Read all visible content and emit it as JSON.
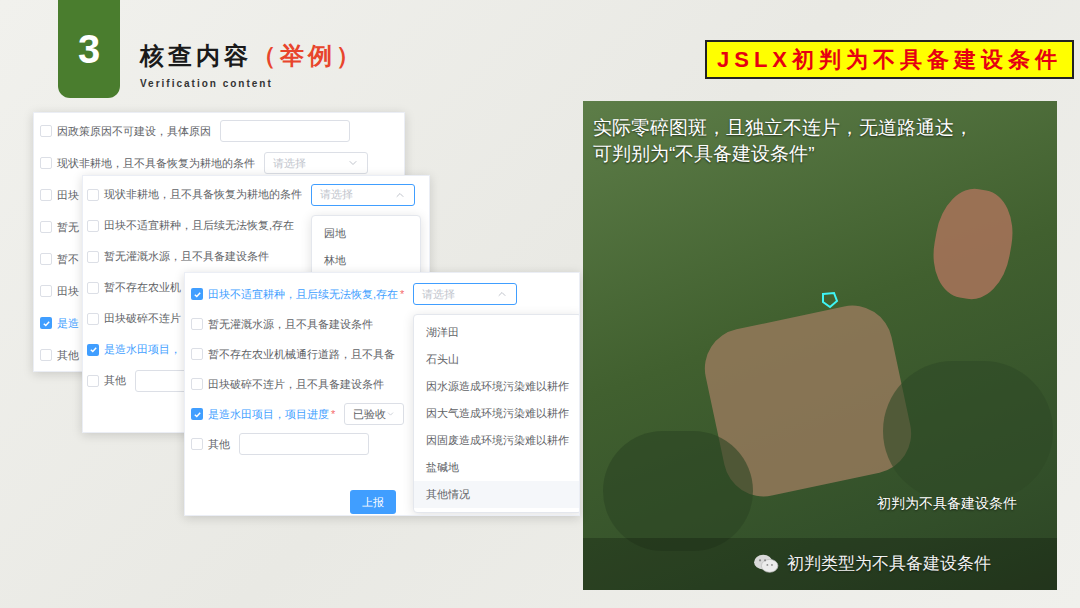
{
  "slide": {
    "number": "3",
    "title": "核查内容",
    "title_note": "（举例）",
    "subtitle": "Verification content",
    "banner": "JSLX初判为不具备建设条件"
  },
  "forms": [
    {
      "rows": [
        {
          "label": "因政策原因不可建设，具体原因",
          "checked": false,
          "mark": "",
          "field": {
            "kind": "input",
            "text": "",
            "placeholder": false,
            "open": false,
            "options": []
          }
        },
        {
          "label": "现状非耕地，且不具备恢复为耕地的条件",
          "checked": false,
          "mark": "",
          "field": {
            "kind": "select",
            "text": "请选择",
            "placeholder": true,
            "open": false,
            "options": []
          }
        },
        {
          "label": "田块",
          "checked": false,
          "mark": "",
          "field": null
        },
        {
          "label": "暂无",
          "checked": false,
          "mark": "",
          "field": null
        },
        {
          "label": "暂不",
          "checked": false,
          "mark": "",
          "field": null
        },
        {
          "label": "田块",
          "checked": false,
          "mark": "",
          "field": null
        },
        {
          "label": "是造",
          "checked": true,
          "mark": "",
          "field": null
        },
        {
          "label": "其他",
          "checked": false,
          "mark": "",
          "field": null
        }
      ],
      "button": null
    },
    {
      "rows": [
        {
          "label": "现状非耕地，且不具备恢复为耕地的条件",
          "checked": false,
          "mark": "",
          "field": {
            "kind": "select",
            "text": "请选择",
            "placeholder": true,
            "open": true,
            "options": [
              {
                "label": "园地",
                "hovered": false
              },
              {
                "label": "林地",
                "hovered": false
              }
            ]
          }
        },
        {
          "label": "田块不适宜耕种，且后续无法恢复,存在",
          "checked": false,
          "mark": "",
          "field": null
        },
        {
          "label": "暂无灌溉水源，且不具备建设条件",
          "checked": false,
          "mark": "",
          "field": null
        },
        {
          "label": "暂不存在农业机",
          "checked": false,
          "mark": "",
          "field": null
        },
        {
          "label": "田块破碎不连片",
          "checked": false,
          "mark": "",
          "field": null
        },
        {
          "label": "是造水田项目，",
          "checked": true,
          "mark": "",
          "field": null
        },
        {
          "label": "其他",
          "checked": false,
          "mark": "",
          "field": {
            "kind": "input",
            "text": "",
            "placeholder": false,
            "open": false,
            "options": []
          }
        }
      ],
      "button": null
    },
    {
      "rows": [
        {
          "label": "田块不适宜耕种，且后续无法恢复,存在",
          "checked": true,
          "mark": "*",
          "field": {
            "kind": "select",
            "text": "请选择",
            "placeholder": true,
            "open": true,
            "options": [
              {
                "label": "湖洋田",
                "hovered": false
              },
              {
                "label": "石头山",
                "hovered": false
              },
              {
                "label": "因水源造成环境污染难以耕作",
                "hovered": false
              },
              {
                "label": "因大气造成环境污染难以耕作",
                "hovered": false
              },
              {
                "label": "因固废造成环境污染难以耕作",
                "hovered": false
              },
              {
                "label": "盐碱地",
                "hovered": false
              },
              {
                "label": "其他情况",
                "hovered": true
              }
            ]
          }
        },
        {
          "label": "暂无灌溉水源，且不具备建设条件",
          "checked": false,
          "mark": "",
          "field": null
        },
        {
          "label": "暂不存在农业机械通行道路，且不具备",
          "checked": false,
          "mark": "",
          "field": null
        },
        {
          "label": "田块破碎不连片，且不具备建设条件",
          "checked": false,
          "mark": "",
          "field": null
        },
        {
          "label": "是造水田项目，项目进度",
          "checked": true,
          "mark": "*",
          "field": {
            "kind": "select",
            "text": "已验收",
            "placeholder": false,
            "open": false,
            "options": []
          }
        },
        {
          "label": "其他",
          "checked": false,
          "mark": "",
          "field": {
            "kind": "input",
            "text": "",
            "placeholder": false,
            "open": false,
            "options": []
          }
        }
      ],
      "button": "上报"
    }
  ],
  "photo": {
    "caption_lines": [
      "实际零碎图斑，且独立不连片，无道路通达，",
      "可判别为“不具备建设条件”"
    ],
    "label": "初判为不具备建设条件",
    "watermark": "初判类型为不具备建设条件"
  }
}
